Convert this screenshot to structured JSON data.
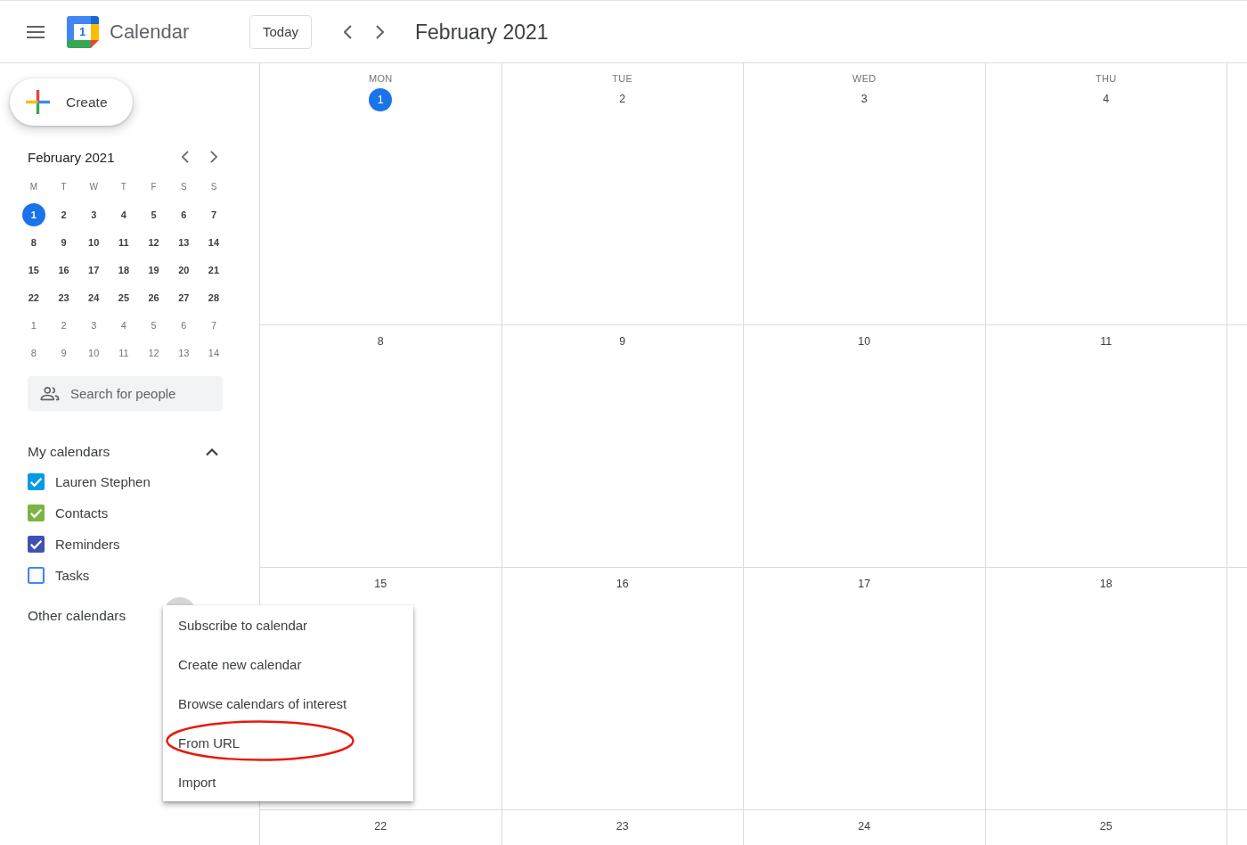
{
  "header": {
    "logo_day": "1",
    "app_name": "Calendar",
    "today_button": "Today",
    "period": "February 2021"
  },
  "sidebar": {
    "create_button": "Create",
    "mini_calendar": {
      "title": "February 2021",
      "weekdays": [
        "M",
        "T",
        "W",
        "T",
        "F",
        "S",
        "S"
      ],
      "weeks": [
        [
          {
            "day": "1",
            "in_month": true,
            "selected": true
          },
          {
            "day": "2",
            "in_month": true,
            "selected": false
          },
          {
            "day": "3",
            "in_month": true,
            "selected": false
          },
          {
            "day": "4",
            "in_month": true,
            "selected": false
          },
          {
            "day": "5",
            "in_month": true,
            "selected": false
          },
          {
            "day": "6",
            "in_month": true,
            "selected": false
          },
          {
            "day": "7",
            "in_month": true,
            "selected": false
          }
        ],
        [
          {
            "day": "8",
            "in_month": true,
            "selected": false
          },
          {
            "day": "9",
            "in_month": true,
            "selected": false
          },
          {
            "day": "10",
            "in_month": true,
            "selected": false
          },
          {
            "day": "11",
            "in_month": true,
            "selected": false
          },
          {
            "day": "12",
            "in_month": true,
            "selected": false
          },
          {
            "day": "13",
            "in_month": true,
            "selected": false
          },
          {
            "day": "14",
            "in_month": true,
            "selected": false
          }
        ],
        [
          {
            "day": "15",
            "in_month": true,
            "selected": false
          },
          {
            "day": "16",
            "in_month": true,
            "selected": false
          },
          {
            "day": "17",
            "in_month": true,
            "selected": false
          },
          {
            "day": "18",
            "in_month": true,
            "selected": false
          },
          {
            "day": "19",
            "in_month": true,
            "selected": false
          },
          {
            "day": "20",
            "in_month": true,
            "selected": false
          },
          {
            "day": "21",
            "in_month": true,
            "selected": false
          }
        ],
        [
          {
            "day": "22",
            "in_month": true,
            "selected": false
          },
          {
            "day": "23",
            "in_month": true,
            "selected": false
          },
          {
            "day": "24",
            "in_month": true,
            "selected": false
          },
          {
            "day": "25",
            "in_month": true,
            "selected": false
          },
          {
            "day": "26",
            "in_month": true,
            "selected": false
          },
          {
            "day": "27",
            "in_month": true,
            "selected": false
          },
          {
            "day": "28",
            "in_month": true,
            "selected": false
          }
        ],
        [
          {
            "day": "1",
            "in_month": false,
            "selected": false
          },
          {
            "day": "2",
            "in_month": false,
            "selected": false
          },
          {
            "day": "3",
            "in_month": false,
            "selected": false
          },
          {
            "day": "4",
            "in_month": false,
            "selected": false
          },
          {
            "day": "5",
            "in_month": false,
            "selected": false
          },
          {
            "day": "6",
            "in_month": false,
            "selected": false
          },
          {
            "day": "7",
            "in_month": false,
            "selected": false
          }
        ],
        [
          {
            "day": "8",
            "in_month": false,
            "selected": false
          },
          {
            "day": "9",
            "in_month": false,
            "selected": false
          },
          {
            "day": "10",
            "in_month": false,
            "selected": false
          },
          {
            "day": "11",
            "in_month": false,
            "selected": false
          },
          {
            "day": "12",
            "in_month": false,
            "selected": false
          },
          {
            "day": "13",
            "in_month": false,
            "selected": false
          },
          {
            "day": "14",
            "in_month": false,
            "selected": false
          }
        ]
      ]
    },
    "people_search": {
      "placeholder": "Search for people"
    },
    "my_calendars": {
      "title": "My calendars",
      "expanded": true,
      "items": [
        {
          "name": "Lauren Stephen",
          "checked": true,
          "color": "#039be5"
        },
        {
          "name": "Contacts",
          "checked": true,
          "color": "#7cb342"
        },
        {
          "name": "Reminders",
          "checked": true,
          "color": "#3f51b5"
        },
        {
          "name": "Tasks",
          "checked": false,
          "color": "#4285f4"
        }
      ]
    },
    "other_calendars": {
      "title": "Other calendars"
    }
  },
  "add_calendar_menu": {
    "items": [
      {
        "label": "Subscribe to calendar",
        "circled": false
      },
      {
        "label": "Create new calendar",
        "circled": false
      },
      {
        "label": "Browse calendars of interest",
        "circled": false
      },
      {
        "label": "From URL",
        "circled": true
      },
      {
        "label": "Import",
        "circled": false
      }
    ]
  },
  "month_view": {
    "weekdays": [
      "MON",
      "TUE",
      "WED",
      "THU"
    ],
    "weeks": [
      [
        {
          "day": "1",
          "selected": true
        },
        {
          "day": "2",
          "selected": false
        },
        {
          "day": "3",
          "selected": false
        },
        {
          "day": "4",
          "selected": false
        }
      ],
      [
        {
          "day": "8",
          "selected": false
        },
        {
          "day": "9",
          "selected": false
        },
        {
          "day": "10",
          "selected": false
        },
        {
          "day": "11",
          "selected": false
        }
      ],
      [
        {
          "day": "15",
          "selected": false
        },
        {
          "day": "16",
          "selected": false
        },
        {
          "day": "17",
          "selected": false
        },
        {
          "day": "18",
          "selected": false
        }
      ],
      [
        {
          "day": "22",
          "selected": false
        },
        {
          "day": "23",
          "selected": false
        },
        {
          "day": "24",
          "selected": false
        },
        {
          "day": "25",
          "selected": false
        }
      ]
    ]
  }
}
